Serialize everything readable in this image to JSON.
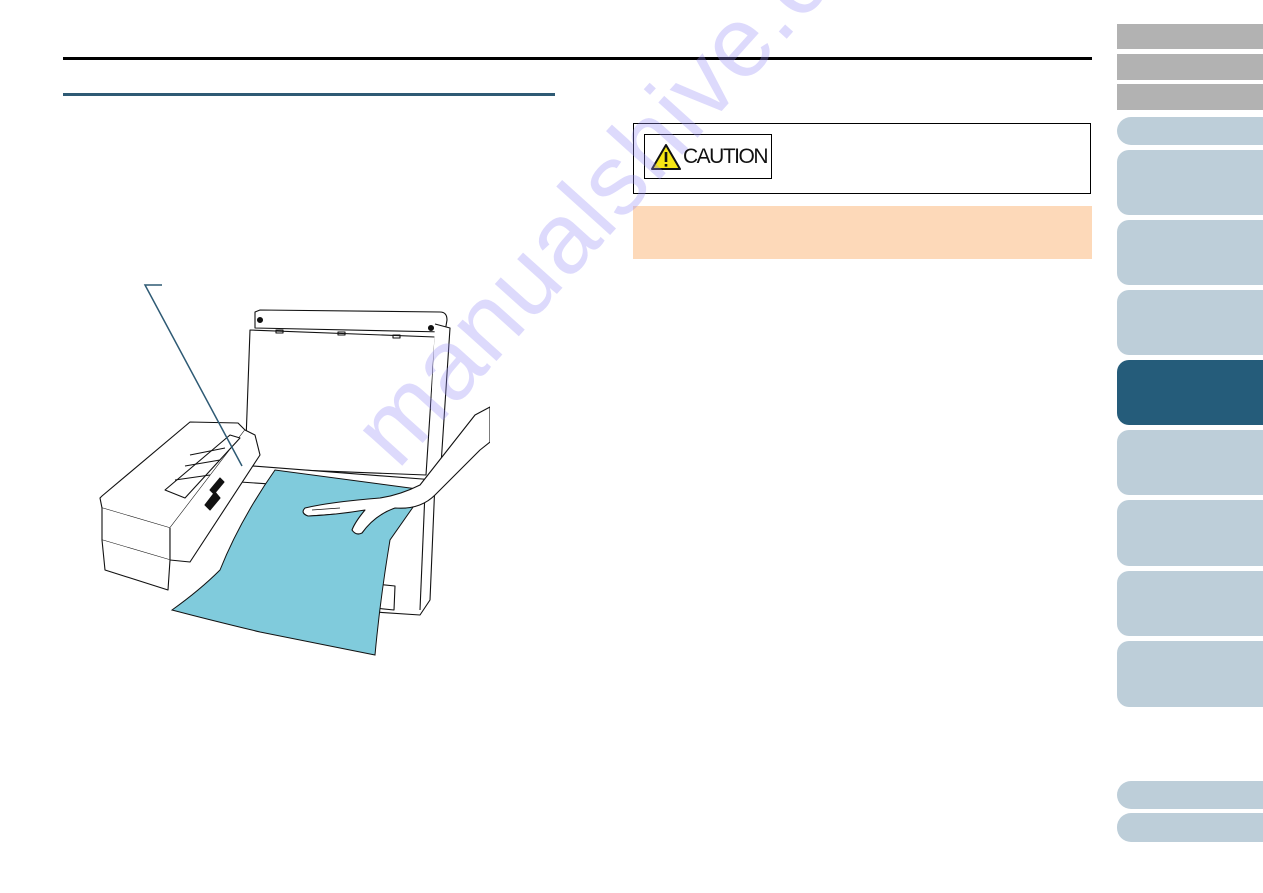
{
  "document": {
    "caution": {
      "label": "CAUTION",
      "icon": "warning-triangle-icon",
      "icon_color": "#f5e514",
      "body_background": "#fdd9b9"
    },
    "illustration": {
      "subject": "scanner-flatbed-with-document-and-hand",
      "paper_color": "#80cbdc",
      "leader_line_color": "#2e5a74"
    },
    "rules": {
      "top_rule_color": "#000000",
      "section_rule_color": "#2e5a74"
    }
  },
  "side_nav": {
    "tabs": [
      {
        "id": "tab-1",
        "style": "gray"
      },
      {
        "id": "tab-2",
        "style": "gray"
      },
      {
        "id": "tab-3",
        "style": "gray"
      },
      {
        "id": "tab-4",
        "style": "pill"
      },
      {
        "id": "tab-5",
        "style": "tall"
      },
      {
        "id": "tab-6",
        "style": "tall"
      },
      {
        "id": "tab-7",
        "style": "tall"
      },
      {
        "id": "tab-8",
        "style": "active"
      },
      {
        "id": "tab-9",
        "style": "tall"
      },
      {
        "id": "tab-10",
        "style": "tall"
      },
      {
        "id": "tab-11",
        "style": "tall"
      },
      {
        "id": "tab-12",
        "style": "tall"
      },
      {
        "id": "tab-13",
        "style": "pill"
      },
      {
        "id": "tab-14",
        "style": "pill"
      }
    ],
    "colors": {
      "gray": "#b2b2b2",
      "inactive": "#bdced9",
      "active": "#255c7a"
    }
  },
  "watermark": {
    "text": "manualshive.com"
  }
}
